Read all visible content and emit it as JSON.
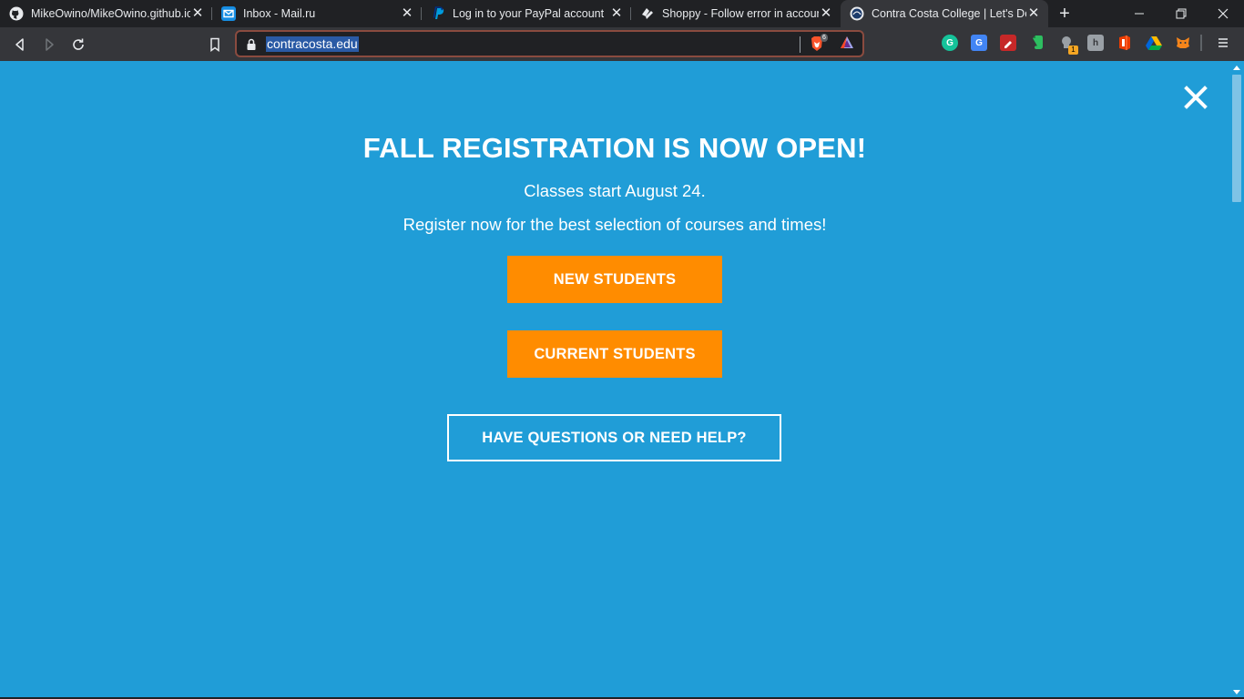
{
  "browser": {
    "tabs": [
      {
        "title": "MikeOwino/MikeOwino.github.io",
        "favicon": "github-icon",
        "active": false
      },
      {
        "title": "Inbox - Mail.ru",
        "favicon": "mailru-icon",
        "active": false
      },
      {
        "title": "Log in to your PayPal account",
        "favicon": "paypal-icon",
        "active": false
      },
      {
        "title": "Shoppy - Follow error in account",
        "favicon": "shoppy-icon",
        "active": false
      },
      {
        "title": "Contra Costa College | Let's Do This",
        "favicon": "contra-costa-icon",
        "active": true
      }
    ],
    "url": "contracosta.edu",
    "brave_shields_count": "6",
    "extensions": [
      {
        "name": "grammarly-icon",
        "color": "#15c39a",
        "label": "G"
      },
      {
        "name": "google-translate-icon",
        "color": "#4285f4",
        "label": "G"
      },
      {
        "name": "color-picker-icon",
        "color": "#c62828",
        "label": ""
      },
      {
        "name": "evernote-icon",
        "color": "#2dbe60",
        "label": ""
      },
      {
        "name": "extension-badge-icon",
        "color": "#9aa0a6",
        "label": "",
        "badge": "1"
      },
      {
        "name": "h-extension-icon",
        "color": "#9aa0a6",
        "label": "h"
      },
      {
        "name": "office-icon",
        "color": "#eb3c00",
        "label": ""
      },
      {
        "name": "google-drive-icon",
        "color": "#f4b400",
        "label": ""
      },
      {
        "name": "metamask-icon",
        "color": "#f6851b",
        "label": ""
      }
    ]
  },
  "modal": {
    "headline": "FALL REGISTRATION IS NOW OPEN!",
    "line1": "Classes start August 24.",
    "line2": "Register now for the best selection of courses and times!",
    "new_students_label": "NEW STUDENTS",
    "current_students_label": "CURRENT STUDENTS",
    "help_label": "HAVE QUESTIONS OR NEED HELP?"
  },
  "colors": {
    "background": "#209dd7",
    "button_orange": "#ff8c00"
  }
}
